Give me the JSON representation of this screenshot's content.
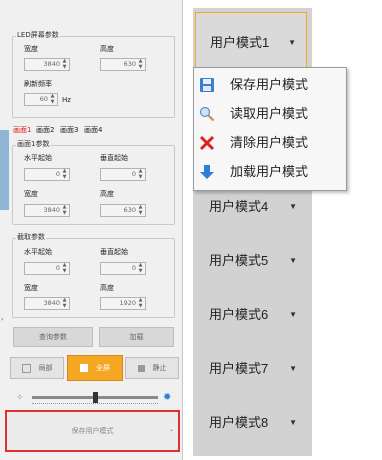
{
  "led_params": {
    "title": "LED屏幕参数",
    "width_label": "宽度",
    "width_value": "3840",
    "height_label": "高度",
    "height_value": "630",
    "refresh_label": "刷新频率",
    "refresh_value": "60",
    "refresh_unit": "Hz"
  },
  "screen_tabs": [
    "画面1",
    "画面2",
    "画面3",
    "画面4"
  ],
  "screen1_params": {
    "title": "画面1参数",
    "h_start_label": "水平起始",
    "h_start_value": "0",
    "v_start_label": "垂直起始",
    "v_start_value": "0",
    "width_label": "宽度",
    "width_value": "3840",
    "height_label": "高度",
    "height_value": "630"
  },
  "capture_params": {
    "title": "截取参数",
    "h_start_label": "水平起始",
    "h_start_value": "0",
    "v_start_label": "垂直起始",
    "v_start_value": "0",
    "width_label": "宽度",
    "width_value": "3840",
    "height_label": "高度",
    "height_value": "1920"
  },
  "actions": {
    "query_label": "查询参数",
    "load_label": "加载"
  },
  "display_mode_buttons": [
    {
      "label": "局部",
      "active": false
    },
    {
      "label": "全屏",
      "active": true
    },
    {
      "label": "静止",
      "active": false
    }
  ],
  "slider_level": 0.5,
  "save_mode_dropdown": {
    "label": "保存用户模式"
  },
  "user_modes": [
    {
      "label": "用户模式1"
    },
    {
      "label": "用户模式4"
    },
    {
      "label": "用户模式5"
    },
    {
      "label": "用户模式6"
    },
    {
      "label": "用户模式7"
    },
    {
      "label": "用户模式8"
    }
  ],
  "context_menu": {
    "items": [
      {
        "label": "保存用户模式",
        "icon": "floppy-icon"
      },
      {
        "label": "读取用户模式",
        "icon": "magnifier-icon"
      },
      {
        "label": "清除用户模式",
        "icon": "red-x-icon"
      },
      {
        "label": "加载用户模式",
        "icon": "down-arrow-icon"
      }
    ]
  },
  "colors": {
    "accent_orange": "#f5a623",
    "highlight_red": "#e03030",
    "tab_red": "#d9201b",
    "menu_delete_red": "#e02020",
    "menu_load_blue": "#2a7fd6"
  }
}
